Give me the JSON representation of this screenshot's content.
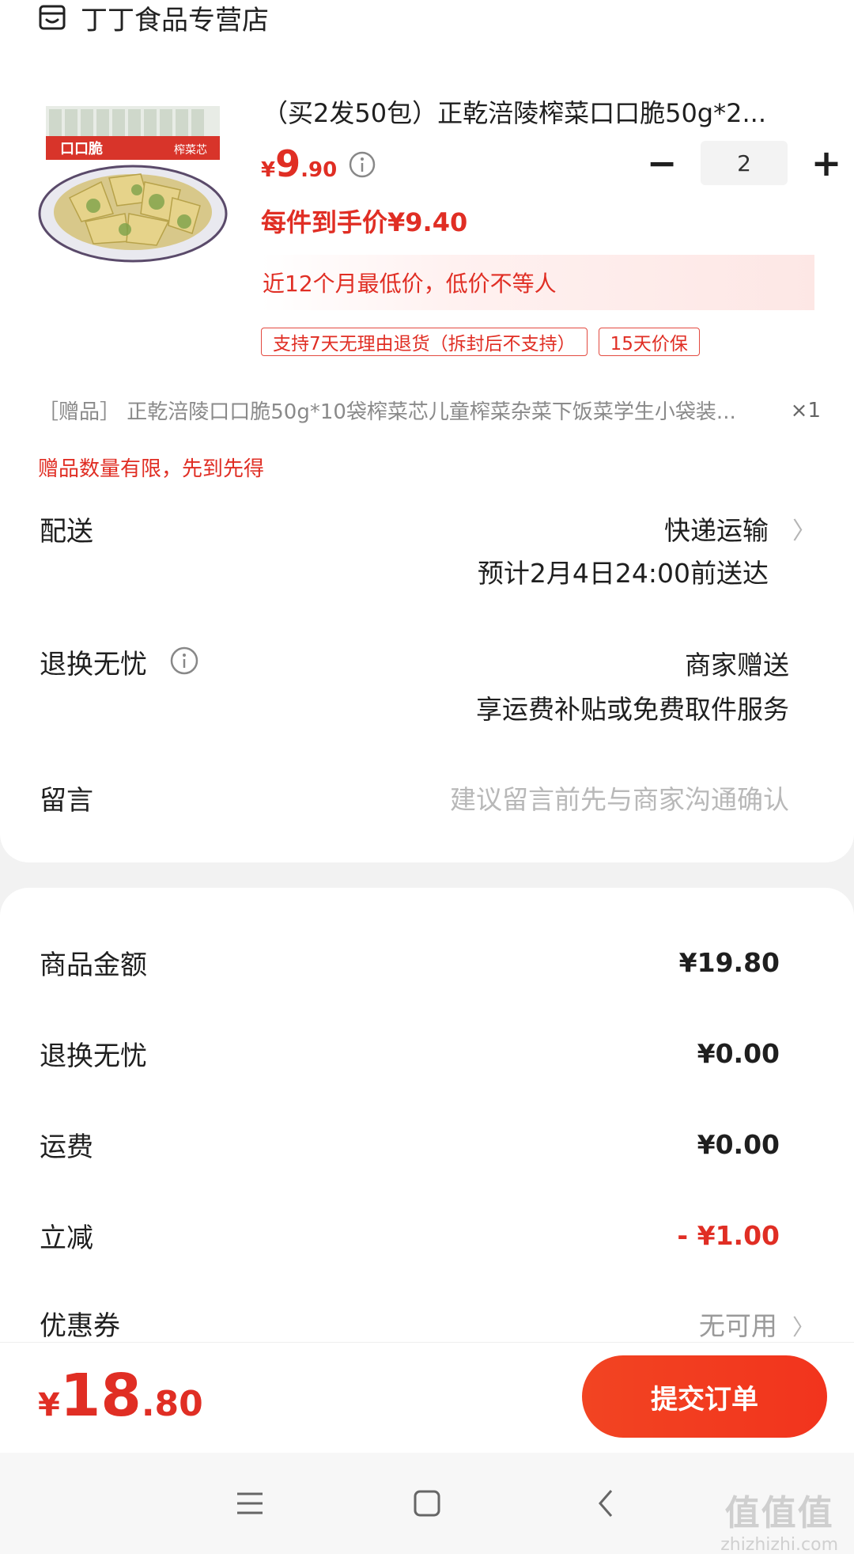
{
  "store": {
    "name": "丁丁食品专营店",
    "icon": "store-icon"
  },
  "product": {
    "title": "（买2发50包）正乾涪陵榨菜口口脆50g*2...",
    "price": {
      "currency": "¥",
      "integer": "9",
      "decimal": ".90"
    },
    "quantity": "2",
    "minus_label": "−",
    "plus_label": "+",
    "unit_price": "每件到手价¥9.40",
    "lowest_note": "近12个月最低价，低价不等人",
    "badges": [
      "支持7天无理由退货（拆封后不支持）",
      "15天价保"
    ],
    "image_text": {
      "brand": "口口脆",
      "sub": "榨菜芯"
    }
  },
  "gift": {
    "text": "［赠品］ 正乾涪陵口口脆50g*10袋榨菜芯儿童榨菜杂菜下饭菜学生小袋装...",
    "qty": "×1",
    "note": "赠品数量有限，先到先得"
  },
  "delivery": {
    "label": "配送",
    "method": "快递运输",
    "eta": "预计2月4日24:00前送达"
  },
  "returns": {
    "label": "退换无忧",
    "line1": "商家赠送",
    "line2": "享运费补贴或免费取件服务"
  },
  "message": {
    "label": "留言",
    "placeholder": "建议留言前先与商家沟通确认"
  },
  "fees": {
    "goods": {
      "label": "商品金额",
      "value": "¥19.80"
    },
    "returns": {
      "label": "退换无忧",
      "value": "¥0.00"
    },
    "shipping": {
      "label": "运费",
      "value": "¥0.00"
    },
    "discount": {
      "label": "立减",
      "value": "- ¥1.00"
    },
    "coupon": {
      "label": "优惠券",
      "value": "无可用"
    }
  },
  "total": {
    "currency": "¥",
    "integer": "18",
    "decimal": ".80"
  },
  "submit_label": "提交订单",
  "watermark": {
    "big": "值值值",
    "small": "zhizhizhi.com"
  },
  "colors": {
    "accent": "#e02e24",
    "button": "#f2341d"
  }
}
